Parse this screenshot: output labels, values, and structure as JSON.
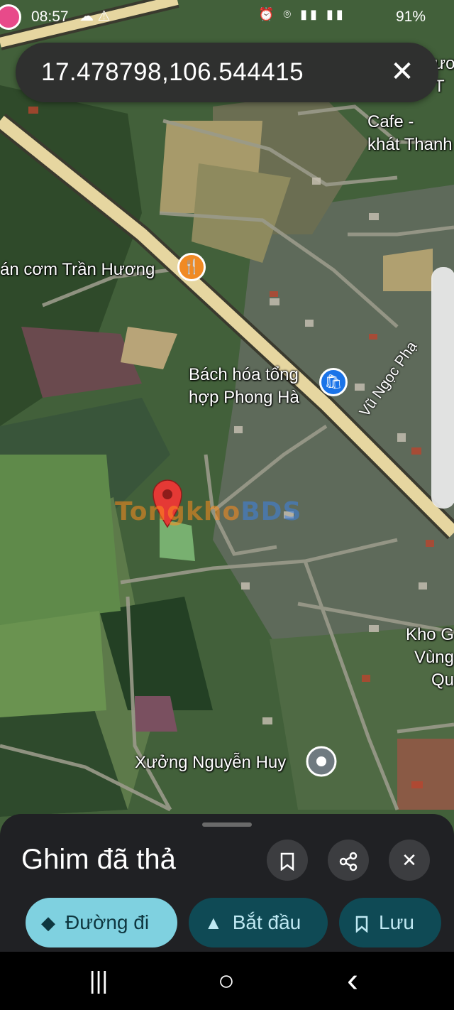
{
  "status": {
    "time": "08:57",
    "left_icons": "☁ ⚠",
    "right_icons": "⏰ ⌾ ▮▮ ▮▮",
    "battery": "91%"
  },
  "search": {
    "value": "17.478798,106.544415",
    "close_icon": "close-icon"
  },
  "map": {
    "labels": {
      "cafe": "Cafe -\nkhát Thanh",
      "restaurant": "án cơm Trần Hương",
      "store": "Bách hóa tổng\nhợp Phong Hà",
      "road": "Vũ Ngọc Phạ",
      "warehouse": "Kho G\nVùng Qu",
      "workshop": "Xưởng Nguyễn Huy",
      "top_right": "ươ\nT"
    },
    "watermark": {
      "part_a": "Tongkho",
      "part_b": "BDS"
    },
    "colors": {
      "pin": "#e53935",
      "restaurant_icon": "#f08a24",
      "store_icon": "#1a73e8",
      "road": "#e6d6a0"
    }
  },
  "sheet": {
    "title": "Ghim đã thả",
    "buttons": {
      "bookmark": "⚐",
      "share": "⋖",
      "close": "✕"
    },
    "actions": [
      {
        "label": "Đường đi",
        "icon": "directions-icon"
      },
      {
        "label": "Bắt đầu",
        "icon": "navigation-arrow-icon"
      },
      {
        "label": "Lưu",
        "icon": "bookmark-icon"
      }
    ]
  },
  "navbar": {
    "recents": "|||",
    "home": "○",
    "back": "‹"
  }
}
